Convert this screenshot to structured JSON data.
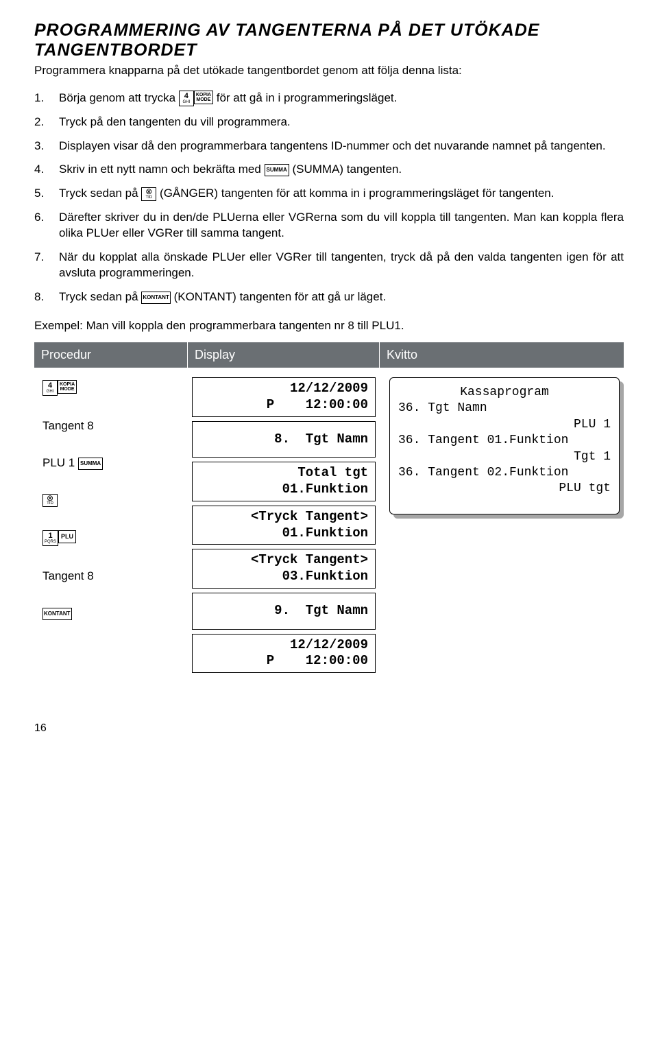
{
  "title": "PROGRAMMERING AV TANGENTERNA PÅ DET UTÖKADE TANGENTBORDET",
  "intro": "Programmera knapparna på det utökade tangentbordet genom att följa denna lista:",
  "keys": {
    "four": {
      "big": "4",
      "small": "GHI"
    },
    "kopia": {
      "top": "KOPIA",
      "bottom": "MODE"
    },
    "summa": "SUMMA",
    "tid": {
      "x": "⊗",
      "small": "TID"
    },
    "kontant": "KONTANT",
    "one": {
      "big": "1",
      "small": "PQRS"
    },
    "plu": "PLU"
  },
  "steps": {
    "s1a": "Börja genom att trycka ",
    "s1b": " för att gå in i programmeringsläget.",
    "s2": "Tryck på den tangenten du vill programmera.",
    "s3": "Displayen visar då den programmerbara tangentens ID-nummer och det nuvarande namnet på tangenten.",
    "s4a": "Skriv in ett nytt namn och bekräfta med ",
    "s4b": " (SUMMA) tangenten.",
    "s5a": "Tryck sedan på ",
    "s5b": " (GÅNGER) tangenten för att komma in i programmerings­läget för tangenten.",
    "s6": "Därefter skriver du in den/de PLUerna eller VGRerna som du vill koppla till tangenten. Man kan koppla flera olika PLUer eller VGRer till samma tangent.",
    "s7": "När du kopplat alla önskade PLUer eller VGRer till tangenten, tryck då på den valda tangenten igen för att avsluta programmeringen.",
    "s8a": "Tryck sedan på ",
    "s8b": " (KONTANT) tangenten för att gå ur läget."
  },
  "example": "Exempel: Man vill koppla den programmerbara tangenten nr 8 till PLU1.",
  "headers": {
    "proc": "Procedur",
    "disp": "Display",
    "kvitto": "Kvitto"
  },
  "proc": {
    "tangent8": "Tangent 8",
    "plu1": "PLU 1 "
  },
  "display": {
    "d1": "12/12/2009\nP    12:00:00",
    "d2": "8.  Tgt Namn",
    "d3": "Total tgt\n01.Funktion",
    "d4": "<Tryck Tangent>\n01.Funktion",
    "d5": "<Tryck Tangent>\n03.Funktion",
    "d6": "9.  Tgt Namn",
    "d7": "12/12/2009\nP    12:00:00"
  },
  "receipt": {
    "r1": "Kassaprogram",
    "r2": "36. Tgt Namn",
    "r3": "PLU 1",
    "r4": "36. Tangent 01.Funktion",
    "r5": "Tgt 1",
    "r6": "36. Tangent 02.Funktion",
    "r7": "PLU tgt"
  },
  "page": "16"
}
